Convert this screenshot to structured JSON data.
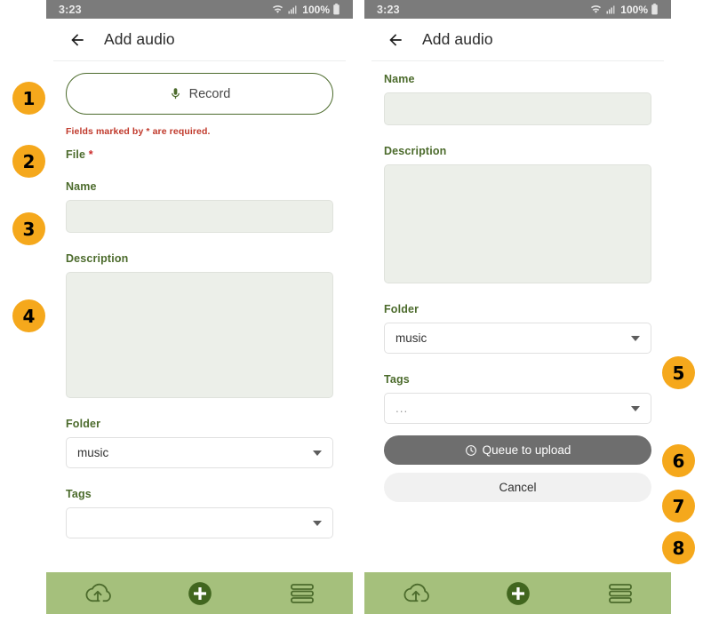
{
  "status_bar": {
    "time": "3:23",
    "battery_percent": "100%",
    "icons": [
      "wifi-icon",
      "cellular-signal-icon",
      "battery-icon"
    ]
  },
  "app_bar": {
    "back_icon": "back-arrow-icon",
    "title": "Add audio"
  },
  "colors": {
    "accent_green": "#4c6b2c",
    "nav_bar_green": "#a5c07c",
    "badge_orange": "#f5a81c",
    "required_red": "#c0392b",
    "input_fill": "#ecefe9",
    "primary_button": "#6e6e6e",
    "secondary_button": "#f1f1f1",
    "status_bar_gray": "#7b7b7b"
  },
  "left_screen": {
    "record_button": {
      "label": "Record",
      "icon": "microphone-icon"
    },
    "required_note": "Fields marked by * are required.",
    "file_label": "File",
    "file_required_marker": "*",
    "name_label": "Name",
    "name_value": "",
    "description_label": "Description",
    "description_value": "",
    "folder_label": "Folder",
    "folder_value": "music",
    "tags_label": "Tags",
    "tags_value": ""
  },
  "right_screen": {
    "name_label": "Name",
    "name_value": "",
    "description_label": "Description",
    "description_value": "",
    "folder_label": "Folder",
    "folder_value": "music",
    "tags_label": "Tags",
    "tags_value": "...",
    "queue_button": {
      "label": "Queue to upload",
      "icon": "clock-icon"
    },
    "cancel_button": {
      "label": "Cancel"
    }
  },
  "bottom_nav": {
    "items": [
      {
        "name": "cloud-upload-icon",
        "label": ""
      },
      {
        "name": "add-plus-icon",
        "label": ""
      },
      {
        "name": "menu-list-icon",
        "label": ""
      }
    ]
  },
  "callouts": [
    {
      "number": "1",
      "target": "record-button"
    },
    {
      "number": "2",
      "target": "file-label"
    },
    {
      "number": "3",
      "target": "name-input"
    },
    {
      "number": "4",
      "target": "description-textarea"
    },
    {
      "number": "5",
      "target": "folder-select"
    },
    {
      "number": "6",
      "target": "tags-select"
    },
    {
      "number": "7",
      "target": "queue-to-upload-button"
    },
    {
      "number": "8",
      "target": "cancel-button"
    }
  ]
}
